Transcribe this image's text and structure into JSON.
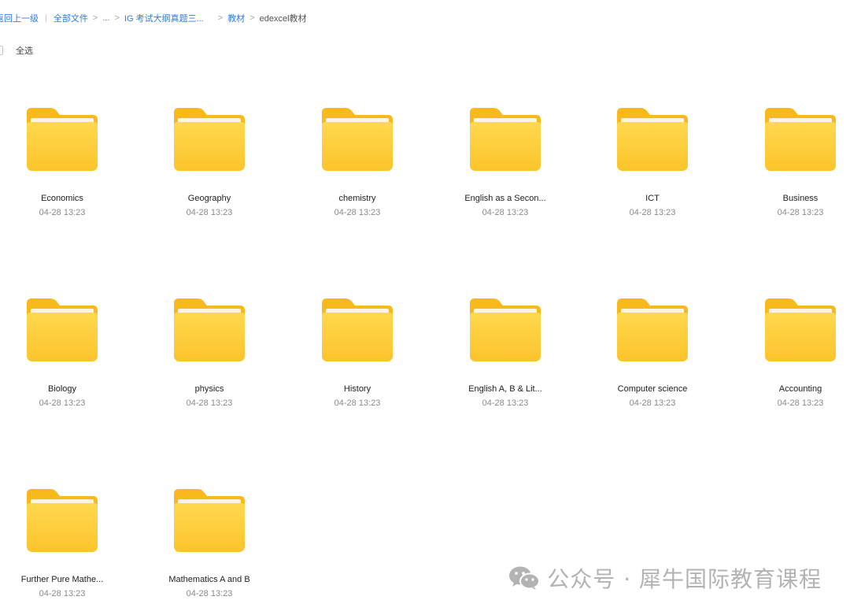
{
  "breadcrumb": {
    "back": "返回上一级",
    "all_files": "全部文件",
    "sep": ">",
    "ellipsis": "...",
    "level1": "IG 考试大纲真题三...",
    "level2": "教材",
    "current": "edexcel教材"
  },
  "select_all": {
    "label": "全选",
    "checked": false
  },
  "folders": [
    {
      "name": "Economics",
      "date": "04-28 13:23"
    },
    {
      "name": "Geography",
      "date": "04-28 13:23"
    },
    {
      "name": "chemistry",
      "date": "04-28 13:23"
    },
    {
      "name": "English as a Secon...",
      "date": "04-28 13:23"
    },
    {
      "name": "ICT",
      "date": "04-28 13:23"
    },
    {
      "name": "Business",
      "date": "04-28 13:23"
    },
    {
      "name": "Biology",
      "date": "04-28 13:23"
    },
    {
      "name": "physics",
      "date": "04-28 13:23"
    },
    {
      "name": "History",
      "date": "04-28 13:23"
    },
    {
      "name": "English A, B & Lit...",
      "date": "04-28 13:23"
    },
    {
      "name": "Computer science",
      "date": "04-28 13:23"
    },
    {
      "name": "Accounting",
      "date": "04-28 13:23"
    },
    {
      "name": "Further Pure Mathe...",
      "date": "04-28 13:23"
    },
    {
      "name": "Mathematics A and B",
      "date": "04-28 13:23"
    }
  ],
  "watermark": {
    "text": "公众号 · 犀牛国际教育课程",
    "icon": "wechat-icon"
  },
  "colors": {
    "link": "#2d7be5",
    "folder_back": "#f8b91d",
    "folder_front_top": "#ffd84f",
    "folder_front_bottom": "#fcc42b",
    "watermark": "#b3b3b3"
  }
}
